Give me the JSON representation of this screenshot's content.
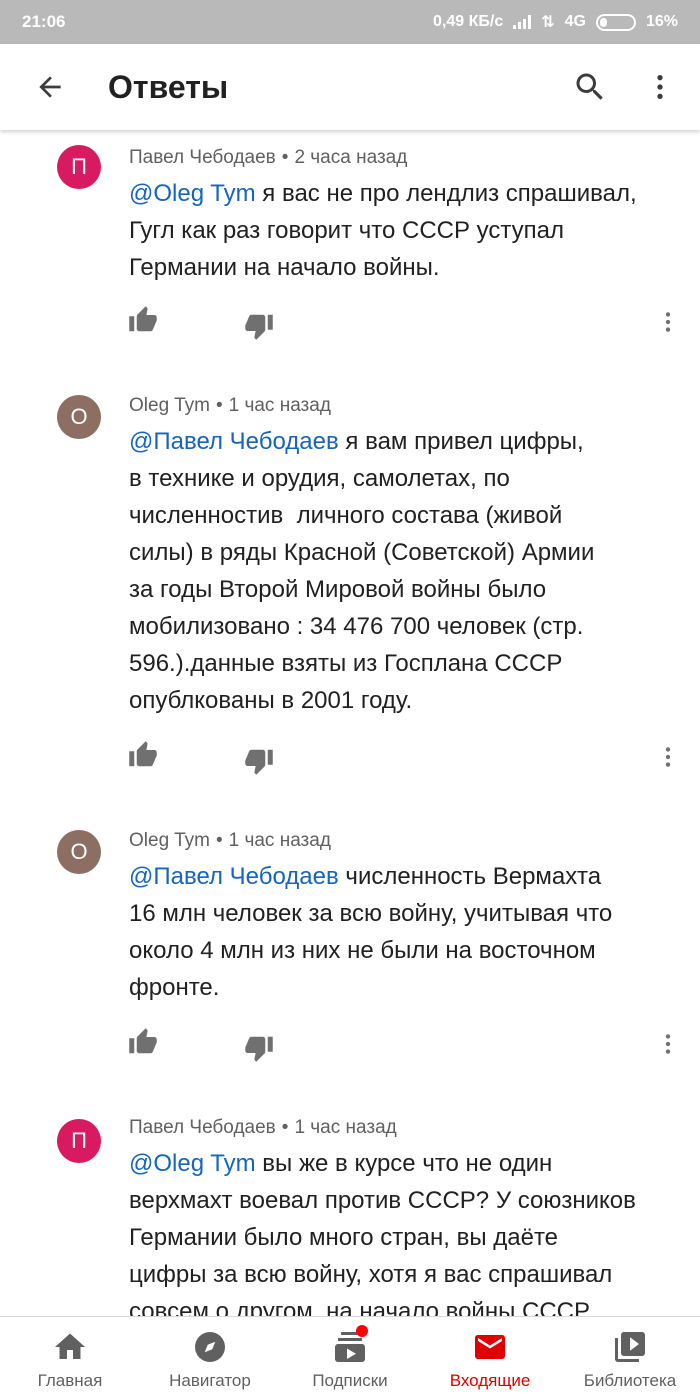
{
  "status_bar": {
    "time": "21:06",
    "speed": "0,49 КБ/с",
    "network": "4G",
    "battery": "16%"
  },
  "app_bar": {
    "title": "Ответы",
    "back_icon": "arrow-back-icon",
    "search_icon": "search-icon",
    "more_icon": "more-vert-icon"
  },
  "comments": [
    {
      "avatar_letter": "П",
      "avatar_color": "#d81b60",
      "author": "Павел Чебодаев",
      "separator": "•",
      "time": "2 часа назад",
      "mention": "@Oleg Tym",
      "text": " я вас не про лендлиз спрашивал,\nГугл как раз говорит что СССР уступал\nГермании на начало войны."
    },
    {
      "avatar_letter": "O",
      "avatar_color": "#8d6e63",
      "author": "Oleg Tym",
      "separator": "•",
      "time": "1 час назад",
      "mention": "@Павел Чебодаев",
      "text": " я вам привел цифры,\nв технике и орудия, самолетах, по\nчисленностив  личного состава (живой\nсилы) в ряды Красной (Советской) Армии\nза годы Второй Мировой войны было\nмобилизовано : 34 476 700 человек (стр.\n596.).данные взяты из Госплана СССР\nопублкованы в 2001 году."
    },
    {
      "avatar_letter": "O",
      "avatar_color": "#8d6e63",
      "author": "Oleg Tym",
      "separator": "•",
      "time": "1 час назад",
      "mention": "@Павел Чебодаев",
      "text": " численность Вермахта\n16 млн человек за всю войну, учитывая что\nоколо 4 млн из них не были на восточном\nфронте."
    },
    {
      "avatar_letter": "П",
      "avatar_color": "#d81b60",
      "author": "Павел Чебодаев",
      "separator": "•",
      "time": "1 час назад",
      "mention": "@Oleg Tym",
      "text": " вы же в курсе что не один\nверхмахт воевал против СССР? У союзников\nГермании было много стран, вы даёте\nцифры за всю войну, хотя я вас спрашивал\nсовсем о другом, на начало войны СССР"
    }
  ],
  "bottom_nav": [
    {
      "label": "Главная",
      "icon": "home-icon",
      "active": false
    },
    {
      "label": "Навигатор",
      "icon": "compass-icon",
      "active": false
    },
    {
      "label": "Подписки",
      "icon": "subscriptions-icon",
      "active": false
    },
    {
      "label": "Входящие",
      "icon": "inbox-mail-icon",
      "active": true
    },
    {
      "label": "Библиотека",
      "icon": "library-icon",
      "active": false
    }
  ],
  "colors": {
    "mention": "#1565c0",
    "active_nav": "#e00000",
    "status_bar": "#b9b9b9"
  }
}
